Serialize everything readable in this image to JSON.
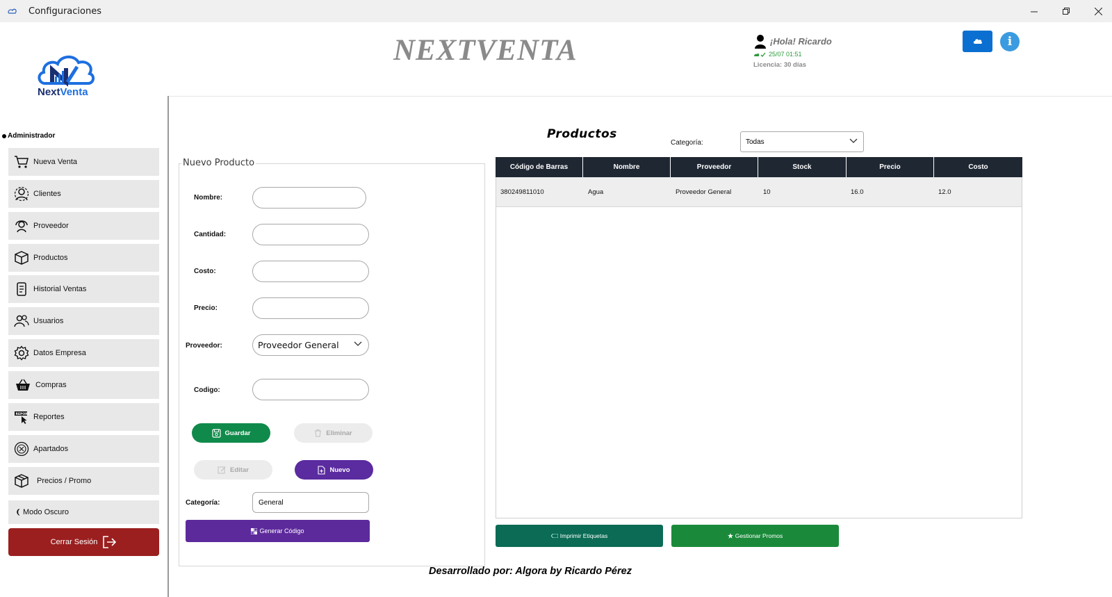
{
  "window": {
    "title": "Configuraciones"
  },
  "header": {
    "brand": "NEXTVENTA",
    "greeting": "¡Hola! Ricardo",
    "sync_status": "25/07 01:51",
    "license": "Licencia: 30 días",
    "info_label": "i"
  },
  "logo": {
    "text_next": "Next",
    "text_venta": "Venta"
  },
  "sidebar": {
    "role": "Administrador",
    "items": [
      {
        "label": "Nueva Venta",
        "icon": "cart-icon"
      },
      {
        "label": "Clientes",
        "icon": "clients-icon"
      },
      {
        "label": "Proveedor",
        "icon": "supplier-icon"
      },
      {
        "label": "Productos",
        "icon": "box-icon"
      },
      {
        "label": "Historial Ventas",
        "icon": "history-icon"
      },
      {
        "label": "Usuarios",
        "icon": "users-icon"
      },
      {
        "label": "Datos Empresa",
        "icon": "gear-icon"
      },
      {
        "label": "Compras",
        "icon": "basket-icon"
      },
      {
        "label": "Reportes",
        "icon": "report-icon"
      },
      {
        "label": "Apartados",
        "icon": "layaway-icon"
      },
      {
        "label": "Precios / Promo",
        "icon": "tag-box-icon"
      }
    ],
    "dark_mode": "Modo Oscuro",
    "logout": "Cerrar Sesión"
  },
  "form": {
    "legend": "Nuevo Producto",
    "labels": {
      "nombre": "Nombre:",
      "cantidad": "Cantidad:",
      "costo": "Costo:",
      "precio": "Precio:",
      "proveedor": "Proveedor:",
      "codigo": "Codigo:",
      "categoria": "Categoría:"
    },
    "values": {
      "nombre": "",
      "cantidad": "",
      "costo": "",
      "precio": "",
      "codigo": ""
    },
    "proveedor_selected": "Proveedor General",
    "categoria_value": "General",
    "buttons": {
      "guardar": "Guardar",
      "eliminar": "Eliminar",
      "editar": "Editar",
      "nuevo": "Nuevo",
      "generar": "Generar Código"
    }
  },
  "products": {
    "title": "Productos",
    "category_label": "Categoría:",
    "category_selected": "Todas",
    "columns": [
      "Código de Barras",
      "Nombre",
      "Proveedor",
      "Stock",
      "Precio",
      "Costo"
    ],
    "rows": [
      [
        "380249811010",
        "Agua",
        "Proveedor General",
        "10",
        "16.0",
        "12.0"
      ]
    ],
    "print_labels": "Imprimir Etiquetas",
    "manage_promos": "Gestionar Promos"
  },
  "footer": {
    "credit": "Desarrollado por: Algora by Ricardo Pérez"
  },
  "colors": {
    "sidebar_item": "#e8e8e8",
    "logout": "#9b1f1f",
    "save": "#0f8a4a",
    "new": "#5b2ba0",
    "generate": "#5d2a9c",
    "print": "#0b6b55",
    "promos": "#1a8a3a",
    "table_header": "#1f2733",
    "cloud": "#0a6fd0",
    "info": "#3b9be0"
  }
}
